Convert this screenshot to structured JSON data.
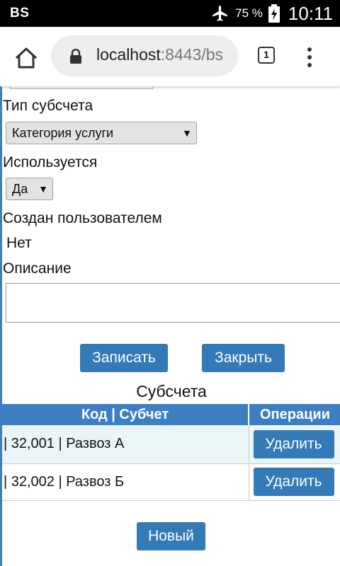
{
  "status_bar": {
    "carrier": "BS",
    "battery_percent": "75 %",
    "time": "10:11",
    "icons": [
      "airplane-icon",
      "battery-charging-icon"
    ]
  },
  "browser": {
    "url_host": "localhost",
    "url_rest": ":8443/bs",
    "tab_count": "1",
    "icons": [
      "home-icon",
      "lock-icon",
      "tabs-icon",
      "more-vert-icon"
    ]
  },
  "form": {
    "subaccount_type_label": "Тип субсчета",
    "subaccount_type_value": "Категория услуги",
    "used_label": "Используется",
    "used_value": "Да",
    "created_by_user_label": "Создан пользователем",
    "created_by_user_value": "Нет",
    "description_label": "Описание",
    "description_value": "",
    "save_label": "Записать",
    "close_label": "Закрыть"
  },
  "subaccounts": {
    "title": "Субсчета",
    "columns": [
      "Код | Субчет",
      "Операции"
    ],
    "rows": [
      {
        "text": "| 32,001 | Развоз А",
        "action": "Удалить"
      },
      {
        "text": "| 32,002 | Развоз Б",
        "action": "Удалить"
      }
    ],
    "new_label": "Новый"
  },
  "colors": {
    "accent": "#337ab7",
    "header": "#3d7fc0",
    "row_alt": "#e9f5f6"
  }
}
